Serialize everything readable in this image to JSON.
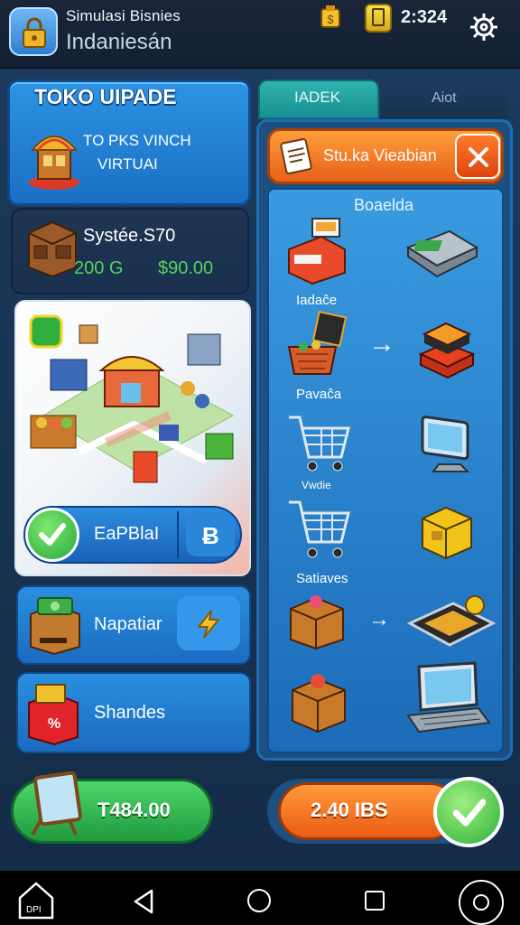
{
  "status_bar": {
    "app_title": "Simulasi Bisnies",
    "app_subtitle": "Indaniesán",
    "clock": "2:324",
    "icons": [
      "app-lock-icon",
      "coin-icon",
      "wallet-icon",
      "gear-icon"
    ]
  },
  "left": {
    "promo": {
      "title": "TOKO UIPADE",
      "line1": "TO PKS VINCH",
      "line2": "VIRTUAI"
    },
    "stats": {
      "label": "Systée.S70",
      "count": "200 G",
      "money": "$90.00"
    },
    "map_card": {
      "confirm_label": "EaPBlaI",
      "action_symbol": "Ƀ"
    },
    "nap_card": {
      "label": "Napatiar"
    },
    "shan_card": {
      "label": "Shandes"
    }
  },
  "tabs": [
    {
      "label": "IADEK",
      "active": true
    },
    {
      "label": "Aiot",
      "active": false
    }
  ],
  "right_panel": {
    "header_title": "Stu.ka Vieabian",
    "subtitle": "Boaelda",
    "labels": [
      "Iadaĉe",
      "Pavaĉa",
      "Vwdie",
      "Satiaves"
    ],
    "arrows": [
      "→",
      "→"
    ]
  },
  "bottom": {
    "left_button": "T484.00",
    "right_button": "2.40 IBS"
  },
  "navbar": {
    "home_label": "DPI"
  },
  "colors": {
    "accent_blue": "#1f77cc",
    "accent_orange": "#ee6a1c",
    "accent_green": "#2fae3b",
    "money_green": "#53d35b"
  }
}
